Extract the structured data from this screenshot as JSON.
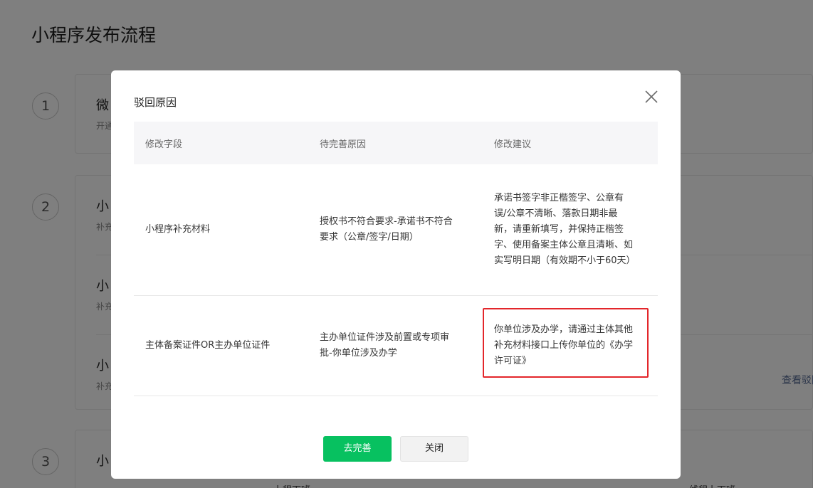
{
  "page": {
    "title": "小程序发布流程",
    "steps": [
      {
        "num": "1",
        "title": "微",
        "sub": "开通"
      },
      {
        "num": "2",
        "rows": [
          {
            "title": "小",
            "sub": "补充"
          },
          {
            "title": "小",
            "sub": "补充"
          },
          {
            "title": "小",
            "sub": "补充"
          }
        ]
      },
      {
        "num": "3",
        "title": "小"
      }
    ],
    "view_link": "查看驳回",
    "bottom_tabs": [
      "上程下班",
      "线程上下班"
    ]
  },
  "dialog": {
    "title": "驳回原因",
    "headers": [
      "修改字段",
      "待完善原因",
      "修改建议"
    ],
    "rows": [
      {
        "field": "小程序补充材料",
        "reason_lines": [
          "授权书不符合要求-承诺书不符合",
          "要求（公章/签字/日期）"
        ],
        "suggestion_lines": [
          "承诺书签字非正楷签字、公章有",
          "误/公章不清晰、落款日期非最",
          "新，请重新填写，并保持正楷签",
          "字、使用备案主体公章且清晰、如",
          "实写明日期（有效期不小于60天）"
        ]
      },
      {
        "field": "主体备案证件OR主办单位证件",
        "reason_lines": [
          "主办单位证件涉及前置或专项审",
          "批-你单位涉及办学"
        ],
        "suggestion_lines": [
          "你单位涉及办学，请通过主体其他",
          "补充材料接口上传你单位的《办学",
          "许可证》"
        ]
      }
    ],
    "primary_button": "去完善",
    "close_button": "关闭"
  },
  "colors": {
    "primary": "#07c160",
    "highlight": "#e3262b",
    "link": "#576b95"
  }
}
